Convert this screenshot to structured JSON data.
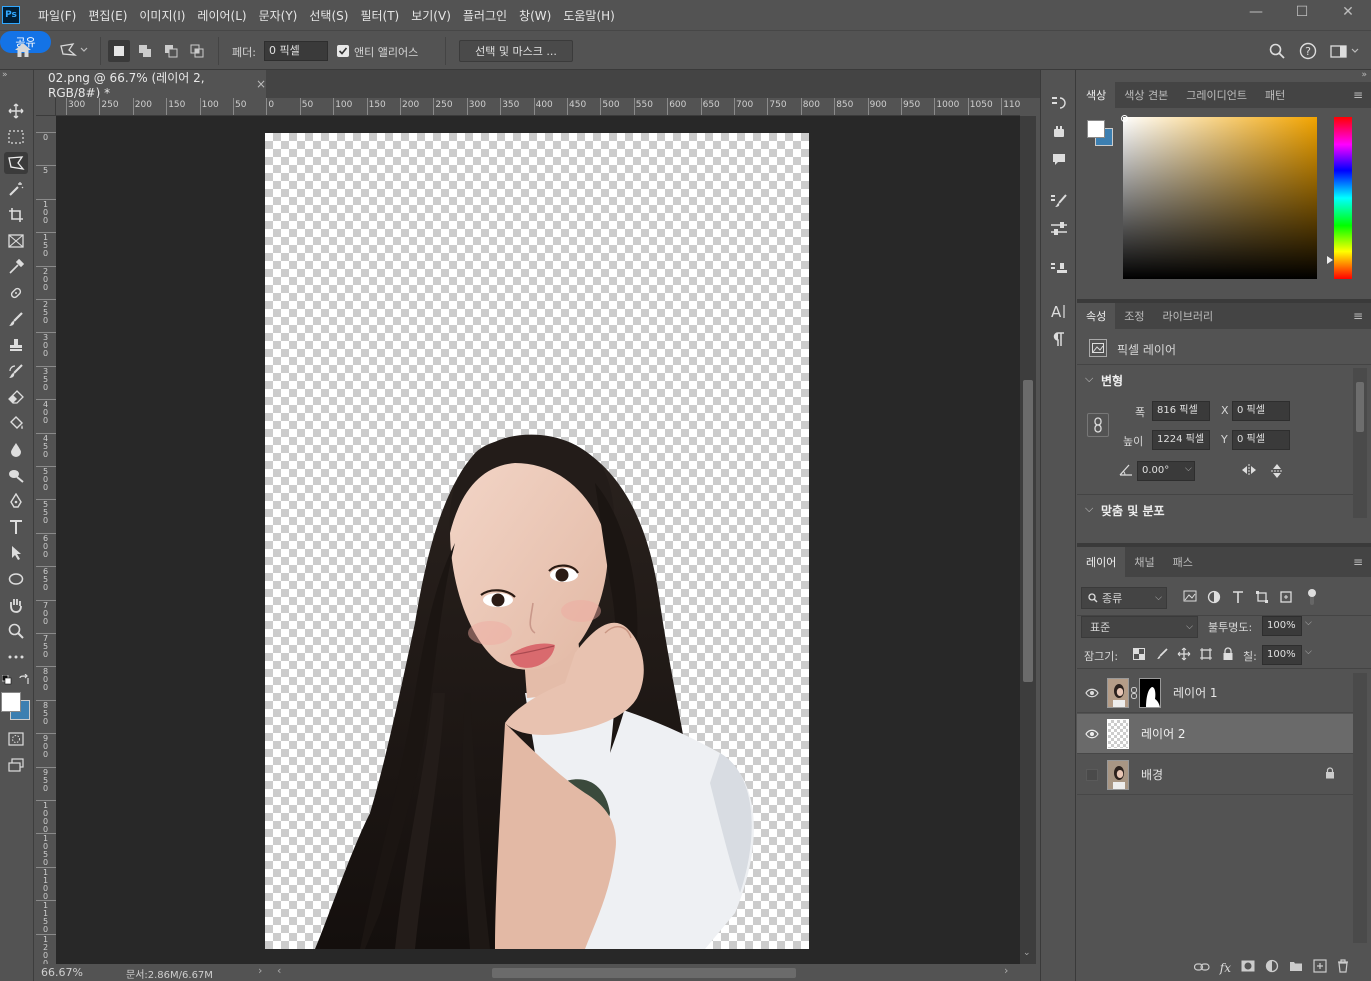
{
  "app": {
    "logo": "Ps"
  },
  "menu": [
    "파일(F)",
    "편집(E)",
    "이미지(I)",
    "레이어(L)",
    "문자(Y)",
    "선택(S)",
    "필터(T)",
    "보기(V)",
    "플러그인",
    "창(W)",
    "도움말(H)"
  ],
  "window_controls": [
    "—",
    "☐",
    "✕"
  ],
  "options": {
    "feather_label": "페더:",
    "feather_value": "0 픽셀",
    "antialias_label": "앤티 앨리어스",
    "antialias_checked": true,
    "select_mask_label": "선택 및 마스크 ...",
    "share_label": "공유"
  },
  "document": {
    "tab_title": "02.png @ 66.7% (레이어 2, RGB/8#) *",
    "close": "×",
    "ruler_top": [
      "300",
      "250",
      "200",
      "150",
      "100",
      "50",
      "0",
      "50",
      "100",
      "150",
      "200",
      "250",
      "300",
      "350",
      "400",
      "450",
      "500",
      "550",
      "600",
      "650",
      "700",
      "750",
      "800",
      "850",
      "900",
      "950",
      "1000",
      "1050",
      "1100"
    ],
    "ruler_left": [
      "0",
      "5",
      "1 0 0",
      "1 5 0",
      "2 0 0",
      "2 5 0",
      "3 0 0",
      "3 5 0",
      "4 0 0",
      "4 5 0",
      "5 0 0",
      "5 5 0",
      "6 0 0",
      "6 5 0",
      "7 0 0",
      "7 5 0",
      "8 0 0",
      "8 5 0",
      "9 0 0",
      "9 5 0",
      "1 0 0 0",
      "1 0 5 0",
      "1 1 0 0",
      "1 1 5 0",
      "1 2 0 0"
    ],
    "zoom": "66.67%",
    "doc_size": "문서:2.86M/6.67M"
  },
  "color_panel": {
    "tabs": [
      "색상",
      "색상 견본",
      "그레이디언트",
      "패턴"
    ],
    "active": 0,
    "hue_color": "#f2a400"
  },
  "properties_panel": {
    "tabs": [
      "속성",
      "조정",
      "라이브러리"
    ],
    "active": 0,
    "layer_type": "픽셀 레이어",
    "section_transform": "변형",
    "width_label": "폭",
    "width_value": "816 픽셀",
    "height_label": "높이",
    "height_value": "1224 픽셀",
    "x_label": "X",
    "x_value": "0 픽셀",
    "y_label": "Y",
    "y_value": "0 픽셀",
    "angle_value": "0.00°",
    "section_align": "맞춤 및 분포"
  },
  "layers_panel": {
    "tabs": [
      "레이어",
      "채널",
      "패스"
    ],
    "active": 0,
    "filter_kind": "종류",
    "blend_mode": "표준",
    "opacity_label": "불투명도:",
    "opacity_value": "100%",
    "lock_label": "잠그기:",
    "fill_label": "칠:",
    "fill_value": "100%",
    "layers": [
      {
        "name": "레이어 1",
        "visible": true,
        "has_mask": true,
        "selected": false,
        "locked": false
      },
      {
        "name": "레이어 2",
        "visible": true,
        "has_mask": false,
        "selected": true,
        "locked": false
      },
      {
        "name": "배경",
        "visible": false,
        "has_mask": false,
        "selected": false,
        "locked": true
      }
    ],
    "footer_icons": [
      "link-icon",
      "fx-icon",
      "add-mask-icon",
      "adjustment-icon",
      "group-icon",
      "new-layer-icon",
      "trash-icon"
    ]
  }
}
